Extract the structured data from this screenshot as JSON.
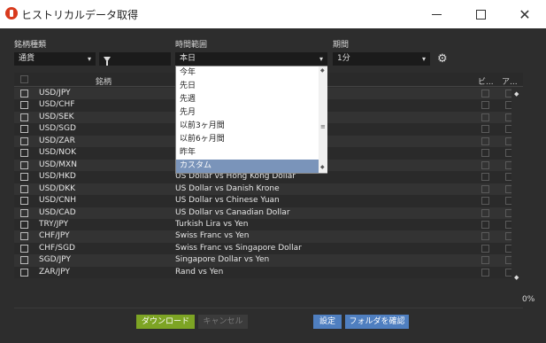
{
  "window": {
    "title": "ヒストリカルデータ取得",
    "minimize_glyph": "",
    "maximize_glyph": "",
    "close_glyph": "✕"
  },
  "filters": {
    "symbol_type_label": "銘柄種類",
    "symbol_type_value": "通貨",
    "time_range_label": "時間範囲",
    "time_range_value": "本日",
    "period_label": "期間",
    "period_value": "1分",
    "arrow": "▾"
  },
  "table": {
    "headers": {
      "symbol": "銘柄",
      "col_b": "ビ...",
      "col_a": "ア..."
    },
    "rows": [
      {
        "symbol": "USD/JPY",
        "name": ""
      },
      {
        "symbol": "USD/CHF",
        "name": ""
      },
      {
        "symbol": "USD/SEK",
        "name": ""
      },
      {
        "symbol": "USD/SGD",
        "name": ""
      },
      {
        "symbol": "USD/ZAR",
        "name": ""
      },
      {
        "symbol": "USD/NOK",
        "name": ""
      },
      {
        "symbol": "USD/MXN",
        "name": ""
      },
      {
        "symbol": "USD/HKD",
        "name": "US Dollar vs Hong Kong Dollar"
      },
      {
        "symbol": "USD/DKK",
        "name": "US Dollar vs Danish Krone"
      },
      {
        "symbol": "USD/CNH",
        "name": "US Dollar vs Chinese Yuan"
      },
      {
        "symbol": "USD/CAD",
        "name": "US Dollar vs Canadian Dollar"
      },
      {
        "symbol": "TRY/JPY",
        "name": "Turkish Lira vs Yen"
      },
      {
        "symbol": "CHF/JPY",
        "name": "Swiss Franc vs Yen"
      },
      {
        "symbol": "CHF/SGD",
        "name": "Swiss Franc vs Singapore Dollar"
      },
      {
        "symbol": "SGD/JPY",
        "name": "Singapore Dollar vs Yen"
      },
      {
        "symbol": "ZAR/JPY",
        "name": "Rand vs Yen"
      }
    ]
  },
  "dropdown": {
    "options": [
      "今年",
      "先日",
      "先週",
      "先月",
      "以前3ヶ月間",
      "以前6ヶ月間",
      "昨年",
      "カスタム"
    ],
    "selected_index": 7
  },
  "progress": {
    "text": "0%",
    "value": 0
  },
  "buttons": {
    "download": "ダウンロード",
    "cancel": "キャンセル",
    "settings": "設定",
    "open_folder": "フォルダを確認"
  },
  "colors": {
    "background": "#2d2d2d",
    "download_button": "#7da424",
    "accent_button": "#4f7fc0",
    "selected_option": "#7a94ba"
  }
}
